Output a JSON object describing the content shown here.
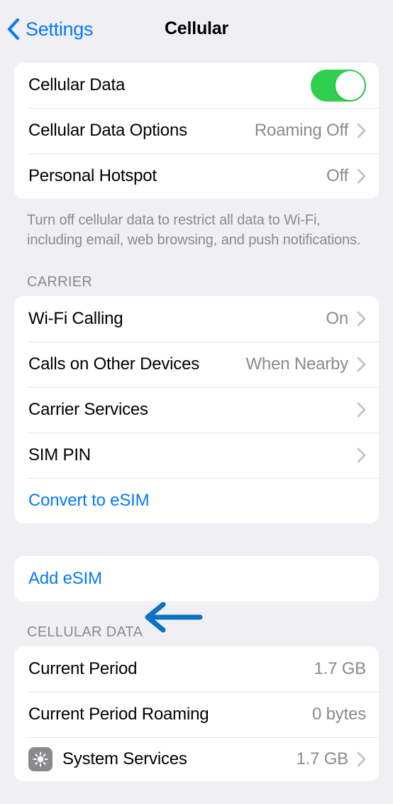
{
  "navbar": {
    "back_label": "Settings",
    "title": "Cellular"
  },
  "sections": {
    "data": {
      "rows": {
        "cellular_data": {
          "label": "Cellular Data",
          "toggle": "on"
        },
        "cellular_data_options": {
          "label": "Cellular Data Options",
          "value": "Roaming Off"
        },
        "personal_hotspot": {
          "label": "Personal Hotspot",
          "value": "Off"
        }
      },
      "footer": "Turn off cellular data to restrict all data to Wi-Fi, including email, web browsing, and push notifications."
    },
    "carrier": {
      "header": "CARRIER",
      "rows": {
        "wifi_calling": {
          "label": "Wi-Fi Calling",
          "value": "On"
        },
        "calls_other_devices": {
          "label": "Calls on Other Devices",
          "value": "When Nearby"
        },
        "carrier_services": {
          "label": "Carrier Services",
          "value": ""
        },
        "sim_pin": {
          "label": "SIM PIN",
          "value": ""
        },
        "convert_esim": {
          "label": "Convert to eSIM"
        }
      }
    },
    "add_esim": {
      "label": "Add eSIM"
    },
    "cellular_data_usage": {
      "header": "CELLULAR DATA",
      "rows": {
        "current_period": {
          "label": "Current Period",
          "value": "1.7 GB"
        },
        "current_period_roaming": {
          "label": "Current Period Roaming",
          "value": "0 bytes"
        },
        "system_services": {
          "label": "System Services",
          "value": "1.7 GB"
        }
      }
    }
  },
  "colors": {
    "accent_blue": "#067AFA",
    "toggle_on_green": "#30CF4F",
    "annotation_blue": "#0B72C4",
    "background": "#F0EFF4",
    "card": "#FFFFFF",
    "secondary_text": "#8A8A8E"
  }
}
